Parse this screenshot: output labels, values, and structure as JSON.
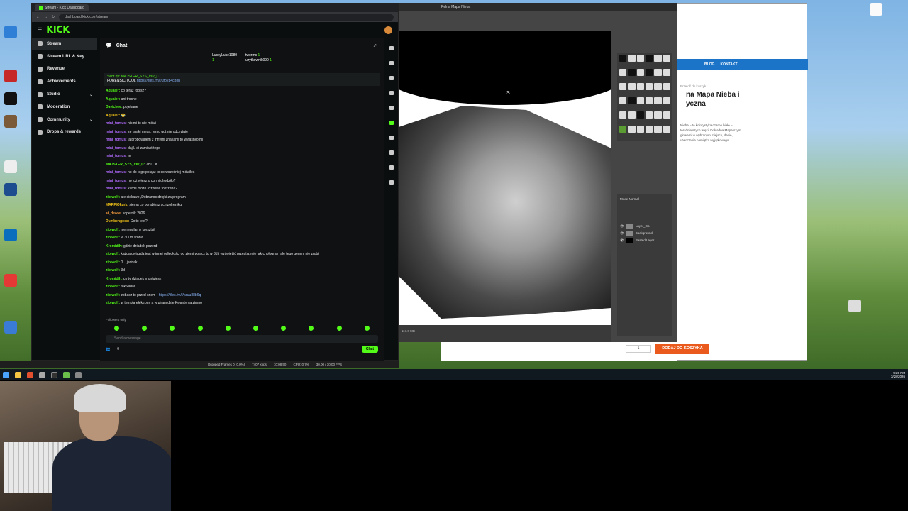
{
  "browser": {
    "tab_title": "Stream - Kick Dashboard",
    "url": "dashboard.kick.com/stream"
  },
  "kick": {
    "logo": "KICK",
    "sidebar": [
      {
        "label": "Stream",
        "active": true
      },
      {
        "label": "Stream URL & Key"
      },
      {
        "label": "Revenue"
      },
      {
        "label": "Achievements"
      },
      {
        "label": "Studio",
        "chevron": true
      },
      {
        "label": "Moderation"
      },
      {
        "label": "Community",
        "chevron": true
      },
      {
        "label": "Drops & rewards"
      }
    ],
    "chat_title": "Chat",
    "gifters": {
      "first": "LuckyLuke1080",
      "first_count": "1",
      "second": "tworms",
      "second_count": "1",
      "third": "uzytkownik090",
      "third_count": "1"
    },
    "pinned": {
      "sent_by": "Sent by:",
      "user": "MAJSTER_SYS_VIP_C",
      "text": "FORENSIC TOOL",
      "link": "https://files.fm/f/ufo284c8hn"
    },
    "messages": [
      {
        "user": "Aquaier:",
        "text": "co teraz robisz?",
        "color": "#53fc18"
      },
      {
        "user": "Aquaier:",
        "text": "ani troche",
        "color": "#53fc18"
      },
      {
        "user": "Davichee:",
        "text": "pojebane",
        "color": "#53fc18"
      },
      {
        "user": "Aquaier:",
        "text": "😂",
        "color": "#f5c518"
      },
      {
        "user": "mini_tomus:",
        "text": "nic mi to nie mówi",
        "color": "#b36bff"
      },
      {
        "user": "mini_tomus:",
        "text": "ze znaki mesa, temu got nie odczytuje",
        "color": "#b36bff"
      },
      {
        "user": "mini_tomus:",
        "text": "ja próbowałem z innymi znakami to wyjaśniło mi",
        "color": "#b36bff"
      },
      {
        "user": "mini_tomus:",
        "text": "daj L ei zamiast tego",
        "color": "#b36bff"
      },
      {
        "user": "mini_tomus:",
        "text": "te",
        "color": "#b36bff"
      },
      {
        "user": "MAJSTER_SYS_VIP_C:",
        "text": "ZBLOK",
        "color": "#53fc18"
      },
      {
        "user": "mini_tomus:",
        "text": "no do tego połącz to co wcześniej mówiłeś",
        "color": "#b36bff"
      },
      {
        "user": "mini_tomus:",
        "text": "no już wiesz o co mi chodziło?",
        "color": "#b36bff"
      },
      {
        "user": "mini_tomus:",
        "text": "kurde może rozpisać to trzeba?",
        "color": "#b36bff"
      },
      {
        "user": "zibiwolf:",
        "text": "ale ciekawe ,Dobranoc dzięki za program",
        "color": "#53fc18"
      },
      {
        "user": "MARFIOkurk:",
        "text": "siema co porabiesz schizofreniku",
        "color": "#f5c518"
      },
      {
        "user": "ai_dewie:",
        "text": "kopernik 2026",
        "color": "#ff9f40"
      },
      {
        "user": "Dumbengoes:",
        "text": "Co to jest?",
        "color": "#f5c518"
      },
      {
        "user": "zibiwolf:",
        "text": "nie regularny kryształ",
        "color": "#53fc18"
      },
      {
        "user": "zibiwolf:",
        "text": "w 3D to zrobić",
        "color": "#53fc18"
      },
      {
        "user": "Kromidih:",
        "text": "gdzie dziadek pozerdl",
        "color": "#53fc18"
      },
      {
        "user": "zibiwolf:",
        "text": "każda gwiazda jest w innej odległości od ziemi połącz to w 3d i wyświetlić przestrzenie jak chologram ale tego gemini nie zrobi",
        "color": "#53fc18"
      },
      {
        "user": "zibiwolf:",
        "text": "0....jednak",
        "color": "#53fc18"
      },
      {
        "user": "zibiwolf:",
        "text": "3d",
        "color": "#53fc18"
      },
      {
        "user": "Kromidih:",
        "text": "co ty dziadek montujesz",
        "color": "#53fc18"
      },
      {
        "user": "zibiwolf:",
        "text": "tak widać",
        "color": "#53fc18"
      },
      {
        "user": "zibiwolf:",
        "text": "zobacz to przed snem -",
        "link": "https://files.fm/f/yzuu88b6q",
        "color": "#53fc18"
      },
      {
        "user": "zibiwolf:",
        "text": "w templa elektrony a w piramidzie Kwanty na zimno",
        "color": "#53fc18"
      }
    ],
    "followers_only": "Followers only",
    "send_placeholder": "Send a message",
    "viewer_count": "0",
    "chat_button": "Chat"
  },
  "obs": {
    "dropped": "Dropped Frames 0 (0.0%)",
    "bitrate": "7407 kbps",
    "time": "10:08:50",
    "cpu": "CPU: 0.7%",
    "fps": "30.00 / 30.00 FPS"
  },
  "gimp": {
    "title": "Pelna Mapa Nieba",
    "starmap_label": "S",
    "layers": [
      "Layer_Ga",
      "Background",
      "Pasted Layer"
    ],
    "mode": "Normal",
    "status": "117.0 MB"
  },
  "shop": {
    "nav": [
      "BLOG",
      "KONTAKT"
    ],
    "breadcrumb": "Przejdź do koszyk",
    "title_line1": "na Mapa Nieba i",
    "title_line2": "yczna",
    "desc": "Nieba – to kolorystyka czarno białe – teraźniejszych więzi. Dokładna Mapa szym głowami w wybranym miejscu, dacie, utworzenia pamiątka wyjątkowego",
    "qty": "1",
    "cart_button": "DODAJ DO KOSZYKA"
  },
  "taskbar": {
    "time": "9:20 PM",
    "date": "3/28/2026"
  },
  "colors": {
    "kick_green": "#53fc18",
    "shop_blue": "#1c74c9",
    "cart_orange": "#ea5a1d"
  }
}
